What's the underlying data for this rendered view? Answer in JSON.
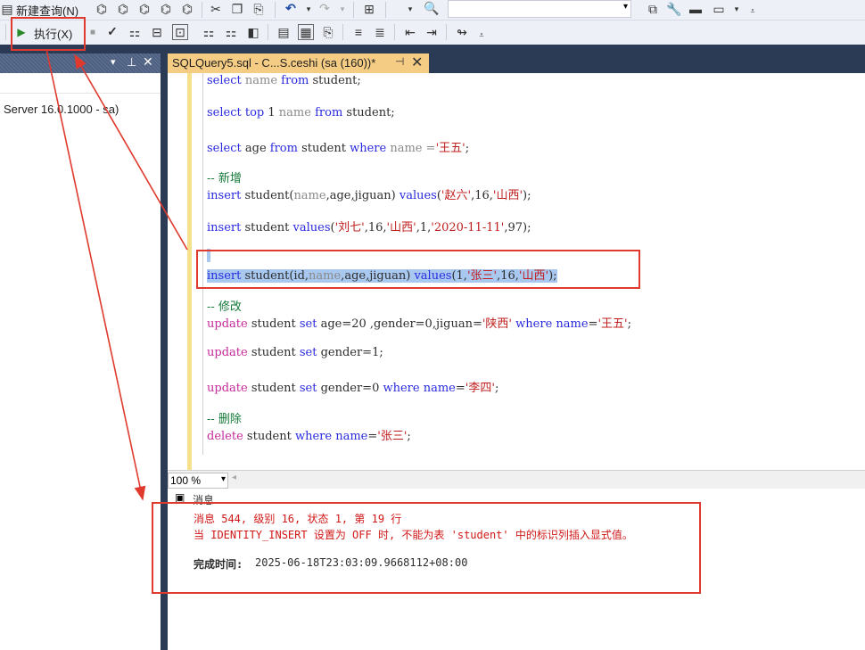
{
  "toolbar1": {
    "new_query_label": "新建查询(N)",
    "icons": [
      "new-query-icon",
      "mdx-icon",
      "dmx-icon",
      "xmla-icon",
      "dax-icon",
      "cut-icon",
      "copy-icon",
      "paste-icon",
      "undo-icon",
      "redo-icon",
      "solution-icon",
      "find-icon"
    ]
  },
  "toolbar2": {
    "execute_label": "执行(X)"
  },
  "left_pane": {
    "server_label": "Server 16.0.1000 - sa)"
  },
  "tab": {
    "title": "SQLQuery5.sql - C...S.ceshi (sa (160))*",
    "pin_glyph": "⊣",
    "close_glyph": "✕"
  },
  "editor": {
    "lines": [
      "select name from student;",
      "select top 1 name from student;",
      "select age from student where name ='王五';",
      "-- 新增",
      "insert student(name,age,jiguan) values('赵六',16,'山西');",
      "insert student values('刘七',16,'山西',1,'2020-11-11',97);",
      "insert student(id,name,age,jiguan) values(1,'张三',16,'山西');",
      "-- 修改",
      "update student set age=20 ,gender=0,jiguan='陕西' where name='王五';",
      "update student set gender=1;",
      "update student set gender=0 where name='李四';",
      "-- 删除",
      "delete student where name='张三';"
    ]
  },
  "zoom": {
    "value": "100 %"
  },
  "messages": {
    "tab_label": "消息",
    "line1": "消息 544, 级别 16, 状态 1, 第 19 行",
    "line2": "当 IDENTITY_INSERT 设置为 OFF 时, 不能为表 'student' 中的标识列插入显式值。",
    "completion_label": "完成时间:",
    "completion_time": "2025-06-18T23:03:09.9668112+08:00"
  },
  "colors": {
    "keyword": "#2a2ae0",
    "string": "#c11f1f",
    "comment": "#157a3a",
    "error": "#d01818",
    "annotation": "#e03a2e",
    "tab_active": "#f5cc84",
    "dark_frame": "#2b3a55"
  }
}
